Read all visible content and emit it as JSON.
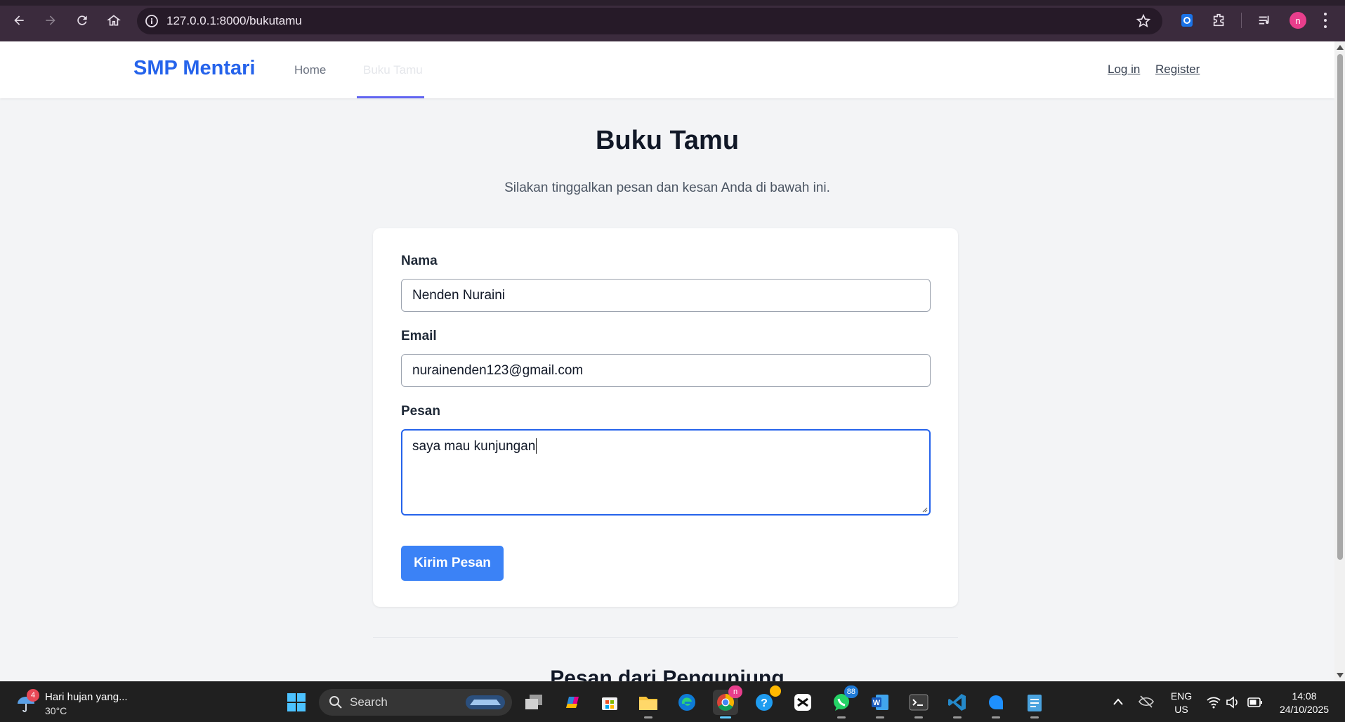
{
  "browser": {
    "url": "127.0.0.1:8000/bukutamu",
    "profile_initial": "n"
  },
  "navbar": {
    "brand": "SMP Mentari",
    "links": [
      {
        "label": "Home"
      },
      {
        "label": "Buku Tamu",
        "active": true
      }
    ],
    "login": "Log in",
    "register": "Register"
  },
  "main": {
    "title": "Buku Tamu",
    "subtitle": "Silakan tinggalkan pesan dan kesan Anda di bawah ini.",
    "form": {
      "name_label": "Nama",
      "name_value": "Nenden Nuraini",
      "email_label": "Email",
      "email_value": "nurainenden123@gmail.com",
      "message_label": "Pesan",
      "message_value": "saya mau kunjungan",
      "submit": "Kirim Pesan"
    },
    "section2_title": "Pesan dari Pengunjung"
  },
  "colors": {
    "brand": "#2563eb",
    "button": "#3b82f6",
    "active_underline": "#6366f1",
    "chrome": "#3b2b3d",
    "taskbar": "#202020"
  },
  "taskbar": {
    "weather_badge": "4",
    "weather_text": "Hari hujan yang...",
    "temperature": "30°C",
    "search_label": "Search",
    "chrome_badge": "n",
    "whatsapp_badge": "88",
    "lang_1": "ENG",
    "lang_2": "US",
    "time": "14:08",
    "date": "24/10/2025",
    "apps": [
      "windows-start",
      "search",
      "task-view",
      "copilot",
      "microsoft-store",
      "file-explorer",
      "edge",
      "chrome",
      "help",
      "capcut",
      "whatsapp",
      "word",
      "terminal",
      "vscode",
      "app",
      "notepad"
    ]
  }
}
